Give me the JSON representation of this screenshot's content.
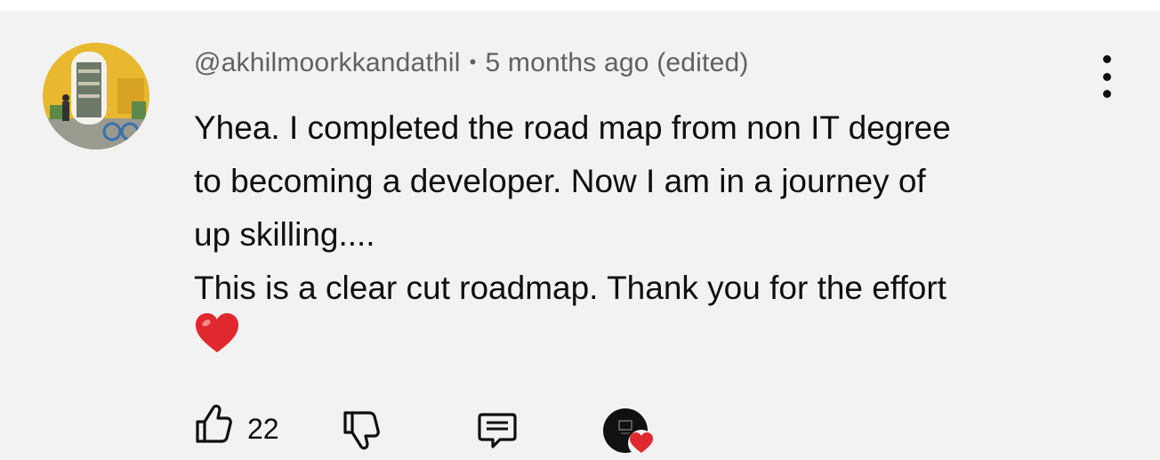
{
  "comment": {
    "author": "@akhilmoorkkandathil",
    "separator": "•",
    "time": "5 months ago (edited)",
    "text_lines": [
      "Yhea. I completed the road map from non IT degree",
      "to becoming a developer. Now I am in a journey of",
      "up skilling....",
      "This is a clear cut roadmap. Thank you for the effort"
    ],
    "emoji": "heart"
  },
  "actions": {
    "like_count": "22",
    "like_icon": "thumbs-up-icon",
    "dislike_icon": "thumbs-down-icon",
    "reply_icon": "comment-icon",
    "creator_heart_icon": "creator-heart-icon"
  },
  "menu_icon": "more-vert-icon",
  "colors": {
    "background": "#f2f2f2",
    "meta_text": "#606060",
    "body_text": "#0f0f0f",
    "heart": "#e0282f"
  }
}
